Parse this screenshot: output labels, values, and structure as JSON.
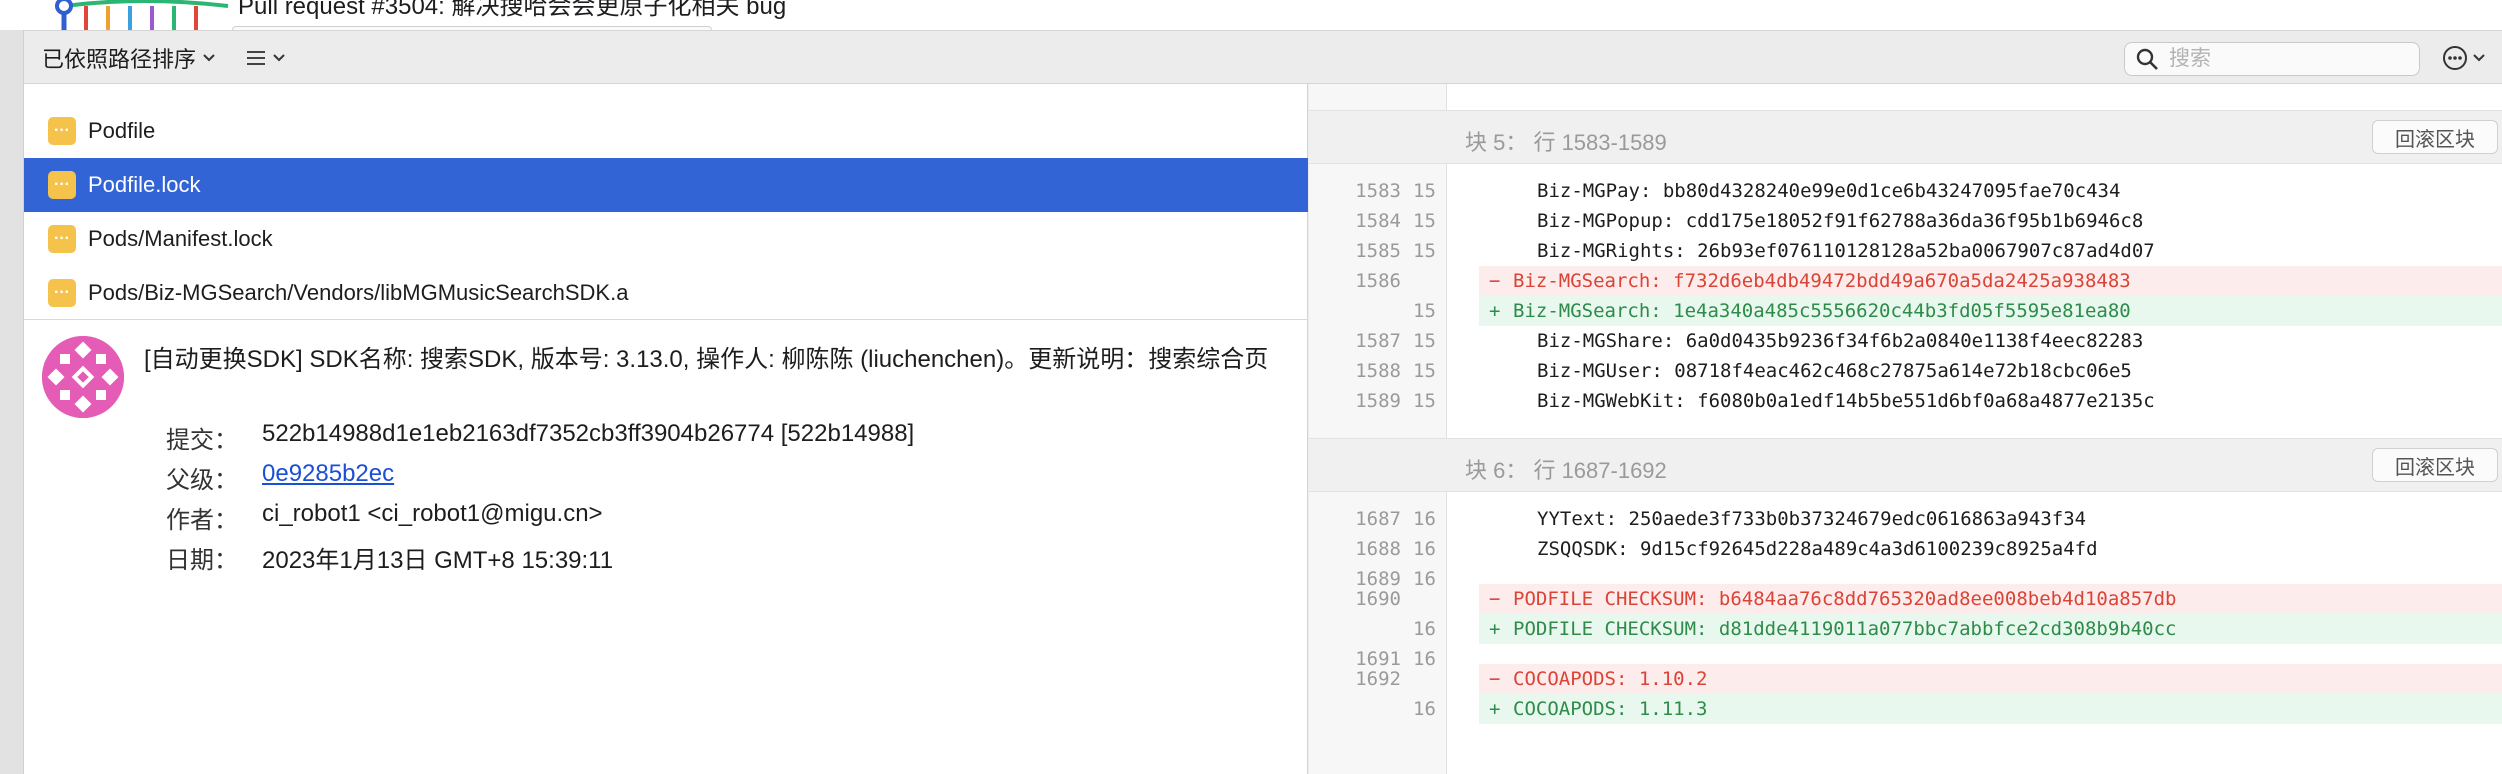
{
  "top": {
    "pr_text": "Pull request #3504: 解决搜哈会会更原子化相关 bug"
  },
  "toolbar": {
    "sort_label": "已依照路径排序",
    "search_placeholder": "搜索"
  },
  "files": [
    {
      "name": "Podfile",
      "selected": false
    },
    {
      "name": "Podfile.lock",
      "selected": true
    },
    {
      "name": "Pods/Manifest.lock",
      "selected": false
    },
    {
      "name": "Pods/Biz-MGSearch/Vendors/libMGMusicSearchSDK.a",
      "selected": false
    }
  ],
  "commit": {
    "message": "[自动更换SDK] SDK名称: 搜索SDK, 版本号: 3.13.0, 操作人: 柳陈陈 (liuchenchen)。更新说明：搜索综合页",
    "labels": {
      "commit": "提交：",
      "parent": "父级：",
      "author": "作者：",
      "date": "日期："
    },
    "hash": "522b14988d1e1eb2163df7352cb3ff3904b26774 [522b14988]",
    "parent": "0e9285b2ec",
    "author": "ci_robot1 <ci_robot1@migu.cn>",
    "date": "2023年1月13日 GMT+8 15:39:11"
  },
  "diff": {
    "hunks": [
      {
        "title": "块 5：  行 1583-1589",
        "button": "回滚区块",
        "lines": [
          {
            "type": "ctx",
            "old": "1583",
            "new": "15",
            "prefix": " ",
            "code": "Biz-MGPay: bb80d4328240e99e0d1ce6b43247095fae70c434"
          },
          {
            "type": "ctx",
            "old": "1584",
            "new": "15",
            "prefix": " ",
            "code": "Biz-MGPopup: cdd175e18052f91f62788a36da36f95b1b6946c8"
          },
          {
            "type": "ctx",
            "old": "1585",
            "new": "15",
            "prefix": " ",
            "code": "Biz-MGRights: 26b93ef076110128128a52ba0067907c87ad4d07"
          },
          {
            "type": "del",
            "old": "1586",
            "new": "",
            "prefix": "−",
            "code": "Biz-MGSearch: f732d6eb4db49472bdd49a670a5da2425a938483"
          },
          {
            "type": "add",
            "old": "",
            "new": "15",
            "prefix": "+",
            "code": "Biz-MGSearch: 1e4a340a485c5556620c44b3fd05f5595e81ea80"
          },
          {
            "type": "ctx",
            "old": "1587",
            "new": "15",
            "prefix": " ",
            "code": "Biz-MGShare: 6a0d0435b9236f34f6b2a0840e1138f4eec82283"
          },
          {
            "type": "ctx",
            "old": "1588",
            "new": "15",
            "prefix": " ",
            "code": "Biz-MGUser: 08718f4eac462c468c27875a614e72b18cbc06e5"
          },
          {
            "type": "ctx",
            "old": "1589",
            "new": "15",
            "prefix": " ",
            "code": "Biz-MGWebKit: f6080b0a1edf14b5be551d6bf0a68a4877e2135c"
          }
        ]
      },
      {
        "title": "块 6：  行 1687-1692",
        "button": "回滚区块",
        "lines": [
          {
            "type": "ctx",
            "old": "1687",
            "new": "16",
            "prefix": " ",
            "code": "YYText: 250aede3f733b0b37324679edc0616863a943f34"
          },
          {
            "type": "ctx",
            "old": "1688",
            "new": "16",
            "prefix": " ",
            "code": "ZSQQSDK: 9d15cf92645d228a489c4a3d6100239c8925a4fd"
          },
          {
            "type": "blank",
            "old": "1689",
            "new": "16",
            "prefix": "",
            "code": ""
          },
          {
            "type": "del",
            "old": "1690",
            "new": "",
            "prefix": "−",
            "code": "PODFILE CHECKSUM: b6484aa76c8dd765320ad8ee008beb4d10a857db"
          },
          {
            "type": "add",
            "old": "",
            "new": "16",
            "prefix": "+",
            "code": "PODFILE CHECKSUM: d81dde4119011a077bbc7abbfce2cd308b9b40cc"
          },
          {
            "type": "blank",
            "old": "1691",
            "new": "16",
            "prefix": "",
            "code": ""
          },
          {
            "type": "del",
            "old": "1692",
            "new": "",
            "prefix": "−",
            "code": "COCOAPODS: 1.10.2"
          },
          {
            "type": "add",
            "old": "",
            "new": "16",
            "prefix": "+",
            "code": "COCOAPODS: 1.11.3"
          }
        ]
      }
    ]
  }
}
